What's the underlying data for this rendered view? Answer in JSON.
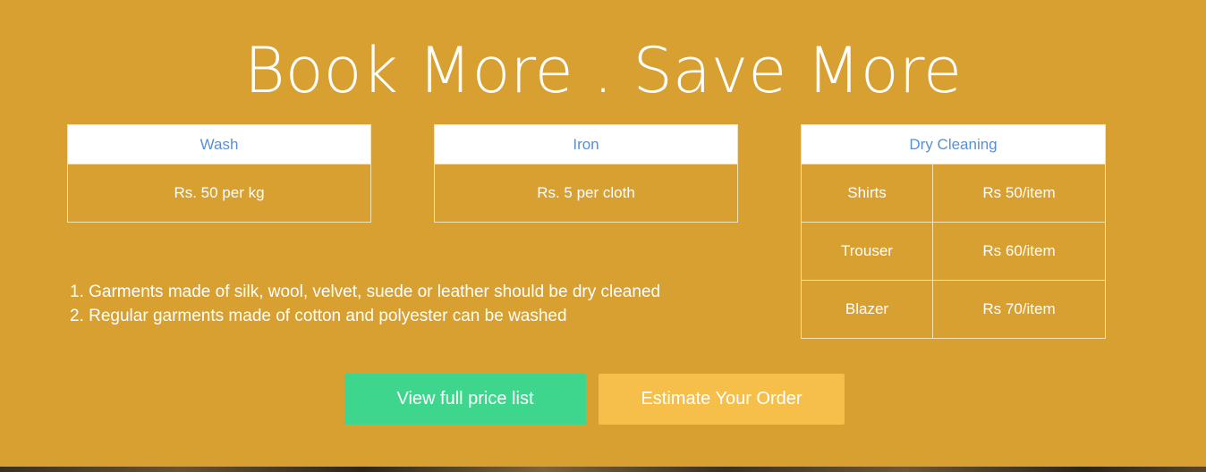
{
  "hero": {
    "title": "Book More . Save More"
  },
  "wash": {
    "header": "Wash",
    "price": "Rs. 50 per kg"
  },
  "iron": {
    "header": "Iron",
    "price": "Rs. 5 per cloth"
  },
  "dry_cleaning": {
    "header": "Dry Cleaning",
    "rows": [
      {
        "item": "Shirts",
        "price": "Rs 50/item"
      },
      {
        "item": "Trouser",
        "price": "Rs 60/item"
      },
      {
        "item": "Blazer",
        "price": "Rs 70/item"
      }
    ]
  },
  "notes": [
    "1. Garments made of silk, wool, velvet, suede or leather should be dry cleaned",
    "2. Regular garments made of cotton and polyester can be washed"
  ],
  "buttons": {
    "view_price_list": "View full price list",
    "estimate_order": "Estimate Your Order"
  },
  "colors": {
    "background": "#d89f31",
    "header_text": "#5b8fd0",
    "primary_button": "#3dd68c",
    "secondary_button": "#f6bf4a"
  }
}
